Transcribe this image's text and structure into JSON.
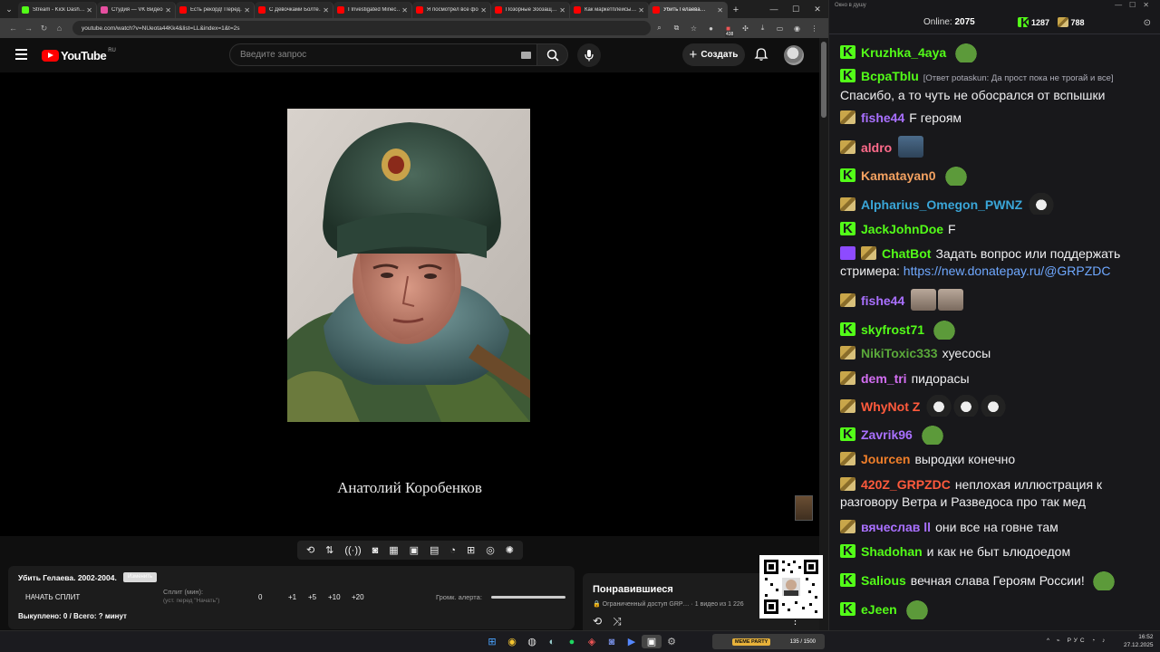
{
  "browser": {
    "tabs": [
      {
        "title": "Stream - Kick Dash…",
        "color": "#53fc18",
        "active": false
      },
      {
        "title": "Студия — VK Видео",
        "color": "#e64fa0",
        "active": false
      },
      {
        "title": "Есть рекорд! Перед…",
        "color": "#ff0000",
        "active": false
      },
      {
        "title": "С Девочками Болте…",
        "color": "#ff0000",
        "active": false
      },
      {
        "title": "I Investigated Minec…",
        "color": "#ff0000",
        "active": false
      },
      {
        "title": "Я посмотрел все фо…",
        "color": "#ff0000",
        "active": false
      },
      {
        "title": "Позорные Зоозащ…",
        "color": "#ff0000",
        "active": false
      },
      {
        "title": "Как маркетплейсы…",
        "color": "#ff0000",
        "active": false
      },
      {
        "title": "Убить Гелаева…",
        "color": "#ff0000",
        "active": true
      }
    ],
    "url": "youtube.com/watch?v=NUeota44Kk4&list=LL&index=1&t=2s",
    "extension_badge": "438"
  },
  "youtube": {
    "logo_text": "YouTube",
    "country": "RU",
    "search_placeholder": "Введите запрос",
    "create_label": "Создать"
  },
  "video": {
    "caption": "Анатолий Коробенков"
  },
  "split_panel": {
    "title": "Убить Гелаева. 2002-2004.",
    "rename_label": "Изменить",
    "start_label": "НАЧАТЬ СПЛИТ",
    "split_label": "Сплит (мин):",
    "split_hint": "(уст. перед \"Начать\")",
    "split_value": "0",
    "buttons": [
      "+1",
      "+5",
      "+10",
      "+20"
    ],
    "alert_volume_label": "Громк. алерта:",
    "status": "Выкуплено: 0 / Всего: ? минут"
  },
  "liked": {
    "title": "Понравившиеся",
    "subtitle": "🔒 Ограниченный доступ GRP… · 1 видео из 1 226"
  },
  "chat": {
    "window_title": "Окно в душу",
    "online_label": "Online:",
    "online_count": "2075",
    "kick_count": "1287",
    "sub_count": "788",
    "messages": [
      {
        "badges": [
          "kick"
        ],
        "user": "Kruzhka_4aya",
        "color": "#53fc18",
        "text": "",
        "emotes": [
          "pepe"
        ]
      },
      {
        "badges": [
          "kick"
        ],
        "user": "BcpaTblu",
        "color": "#53fc18",
        "reply": "[Ответ potaskun: Да прост пока не трогай и все]",
        "text": "Спасибо, а то чуть не обосрался от вспышки",
        "emotes": []
      },
      {
        "badges": [
          "gift"
        ],
        "user": "fishe44",
        "color": "#a970ff",
        "text": "F героям",
        "emotes": []
      },
      {
        "badges": [
          "gift"
        ],
        "user": "aldro",
        "color": "#ff6b8b",
        "text": "",
        "emotes": [
          "pic"
        ]
      },
      {
        "badges": [
          "kick"
        ],
        "user": "Kamatayan0",
        "color": "#f4a261",
        "text": "",
        "emotes": [
          "pepe"
        ]
      },
      {
        "badges": [
          "gift"
        ],
        "user": "Alpharius_Omegon_PWNZ",
        "color": "#3aa6d8",
        "text": "",
        "emotes": [
          "cat"
        ]
      },
      {
        "badges": [
          "kick"
        ],
        "user": "JackJohnDoe",
        "color": "#53fc18",
        "text": "F",
        "emotes": []
      },
      {
        "badges": [
          "bot",
          "gift"
        ],
        "user": "ChatBot",
        "color": "#53fc18",
        "text": "Задать вопрос или поддержать стримера:",
        "link": "https://new.donatepay.ru/@GRPZDC",
        "emotes": []
      },
      {
        "badges": [
          "gift"
        ],
        "user": "fishe44",
        "color": "#a970ff",
        "text": "",
        "emotes": [
          "cats2",
          "cats2"
        ]
      },
      {
        "badges": [
          "kick"
        ],
        "user": "skyfrost71",
        "color": "#53fc18",
        "text": "",
        "emotes": [
          "pepe"
        ]
      },
      {
        "badges": [
          "gift"
        ],
        "user": "NikiToxic333",
        "color": "#5aa83a",
        "text": "хуесосы",
        "emotes": []
      },
      {
        "badges": [
          "gift"
        ],
        "user": "dem_tri",
        "color": "#d36ef2",
        "text": "пидорасы",
        "emotes": []
      },
      {
        "badges": [
          "gift"
        ],
        "user": "WhyNot Z",
        "color": "#ff5a3c",
        "text": "",
        "emotes": [
          "cat",
          "cat",
          "cat"
        ]
      },
      {
        "badges": [
          "kick"
        ],
        "user": "Zavrik96",
        "color": "#a970ff",
        "text": "",
        "emotes": [
          "pepe"
        ]
      },
      {
        "badges": [
          "gift"
        ],
        "user": "Jourcen",
        "color": "#f07f2a",
        "text": "выродки конечно",
        "emotes": []
      },
      {
        "badges": [
          "gift"
        ],
        "user": "420Z_GRPZDC",
        "color": "#ff5a3c",
        "text": "неплохая иллюстрация к разговору Ветра и Разведоса про так мед",
        "emotes": []
      },
      {
        "badges": [
          "gift"
        ],
        "user": "вячеслав ll",
        "color": "#a970ff",
        "text": "они все на говне там",
        "emotes": []
      },
      {
        "badges": [
          "kick"
        ],
        "user": "Shadohan",
        "color": "#53fc18",
        "text": "и как не быт ьлюдоедом",
        "emotes": []
      },
      {
        "badges": [
          "kick"
        ],
        "user": "Salious",
        "color": "#53fc18",
        "text": "вечная слава Героям России!",
        "emotes": [
          "pepe"
        ]
      },
      {
        "badges": [
          "kick"
        ],
        "user": "eJeen",
        "color": "#53fc18",
        "text": "",
        "emotes": [
          "pepe"
        ]
      }
    ]
  },
  "taskbar": {
    "meme_tag": "МЕМЕ PARTY",
    "meme_count": "135 / 1500",
    "lang": "РУС",
    "time": "16:52",
    "date": "27.12.2025"
  }
}
